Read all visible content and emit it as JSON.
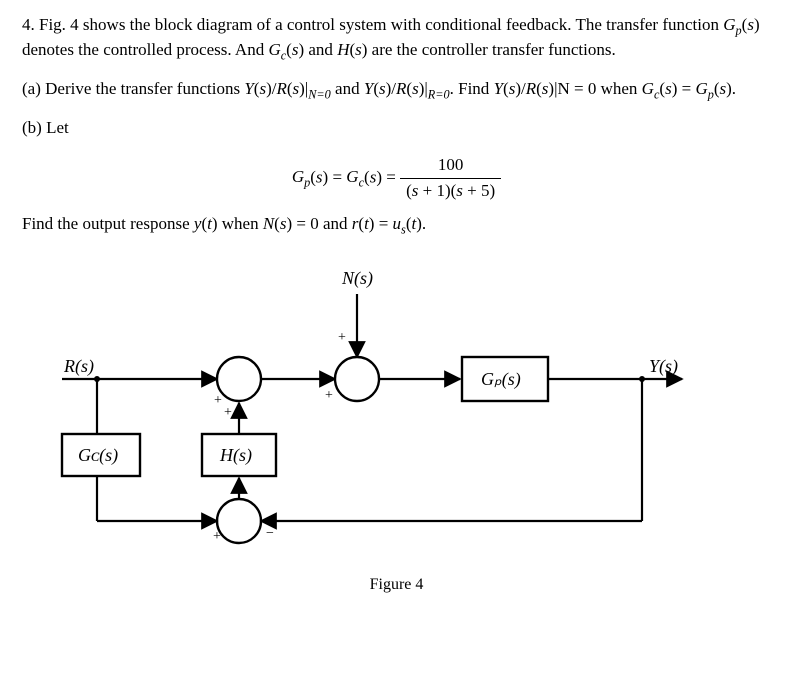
{
  "problem": {
    "intro": "4. Fig. 4 shows the block diagram of a control system with conditional feedback. The transfer function Gₚ(s) denotes the controlled process. And Gᴄ(s) and H(s) are the controller transfer functions.",
    "part_a": "(a) Derive the transfer functions Y(s)/R(s)|ₙ₌₀ and Y(s)/R(s)|ᵣ₌₀. Find Y(s)/R(s)|N = 0 when Gᴄ(s) = Gₚ(s).",
    "part_b_lead": "(b) Let",
    "eq_left": "Gₚ(s) = Gᴄ(s) =",
    "eq_num": "100",
    "eq_den": "(s + 1)(s + 5)",
    "part_b_tail": "Find the output response y(t) when N(s) = 0 and r(t) = uₛ(t)."
  },
  "diagram": {
    "labels": {
      "N": "N(s)",
      "R": "R(s)",
      "Y": "Y(s)",
      "Gc": "Gᴄ(s)",
      "Gp": "Gₚ(s)",
      "H": "H(s)"
    },
    "signs": {
      "sum1_R": "+",
      "sum1_H": "+",
      "sum2_N": "+",
      "sum2_fwd": "+",
      "sum3_Gc": "+",
      "sum3_Y": "−"
    },
    "caption": "Figure 4"
  }
}
